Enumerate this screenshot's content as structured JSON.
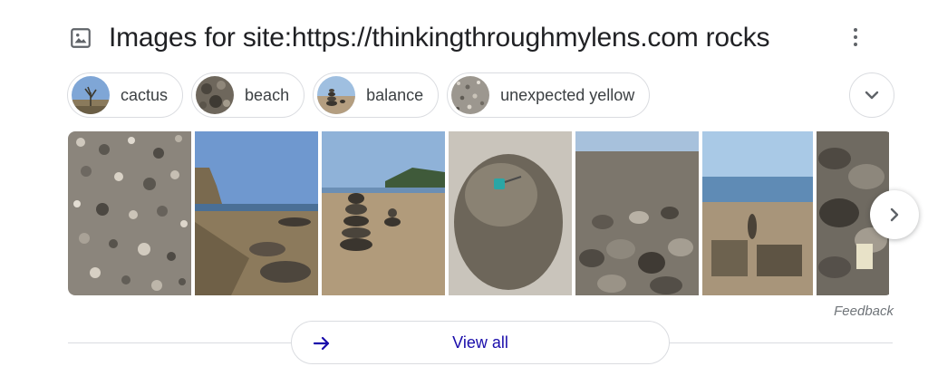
{
  "header": {
    "title": "Images for site:https://thinkingthroughmylens.com rocks",
    "icon": "image-icon",
    "more_icon": "more-vert-icon"
  },
  "chips": [
    {
      "label": "cactus",
      "icon": "cactus-thumbnail"
    },
    {
      "label": "beach",
      "icon": "beach-thumbnail"
    },
    {
      "label": "balance",
      "icon": "balance-thumbnail"
    },
    {
      "label": "unexpected yellow",
      "icon": "unexpected-yellow-thumbnail"
    }
  ],
  "expand_icon": "chevron-down-icon",
  "next_icon": "chevron-right-icon",
  "feedback": "Feedback",
  "view_all": {
    "label": "View all",
    "icon": "arrow-right-icon"
  },
  "colors": {
    "link": "#1a0dab",
    "text": "#202124",
    "border": "#dadce0",
    "muted": "#70757a"
  }
}
